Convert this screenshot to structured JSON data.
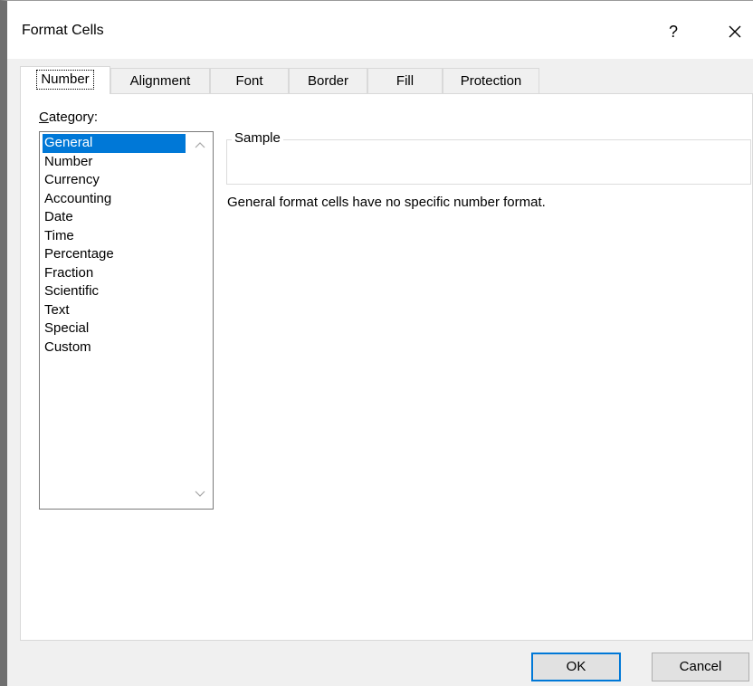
{
  "window": {
    "title": "Format Cells",
    "help_label": "?",
    "close_icon": "close-icon"
  },
  "tabs": [
    {
      "label": "Number",
      "active": true
    },
    {
      "label": "Alignment",
      "active": false
    },
    {
      "label": "Font",
      "active": false
    },
    {
      "label": "Border",
      "active": false
    },
    {
      "label": "Fill",
      "active": false
    },
    {
      "label": "Protection",
      "active": false
    }
  ],
  "category": {
    "label_accel": "C",
    "label_rest": "ategory:",
    "items": [
      "General",
      "Number",
      "Currency",
      "Accounting",
      "Date",
      "Time",
      "Percentage",
      "Fraction",
      "Scientific",
      "Text",
      "Special",
      "Custom"
    ],
    "selected": "General"
  },
  "sample": {
    "legend": "Sample",
    "value": ""
  },
  "description": "General format cells have no specific number format.",
  "buttons": {
    "ok": "OK",
    "cancel": "Cancel"
  },
  "colors": {
    "selection": "#0078d7",
    "dialog_bg": "#f0f0f0"
  }
}
